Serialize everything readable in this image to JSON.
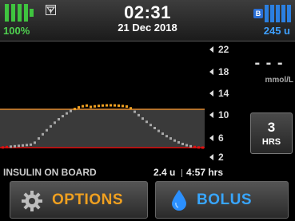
{
  "status": {
    "battery_percent": "100%",
    "battery_level": 1.0,
    "time": "02:31",
    "date": "21 Dec 2018",
    "bolus_badge": "B",
    "insulin_units": "245 u",
    "icons": [
      "battery-icon",
      "signal-icon",
      "insulin-cartridge-icon"
    ]
  },
  "graph": {
    "y_axis_ticks": [
      "22",
      "18",
      "14",
      "10",
      "6",
      "2"
    ],
    "colors": {
      "target_band": "#3a3a3a",
      "high_limit": "#e08a30",
      "low_limit": "#e01010",
      "trace_in_range": "#a8a8a8",
      "trace_high": "#f0a020",
      "trace_low": "#e01010"
    }
  },
  "glucose": {
    "value": "- - -",
    "unit": "mmol/L"
  },
  "time_range": {
    "value": "3",
    "label": "HRS"
  },
  "insulin_on_board": {
    "label": "INSULIN ON BOARD",
    "units": "2.4 u",
    "time": "4:57 hrs"
  },
  "buttons": {
    "options_label": "OPTIONS",
    "bolus_label": "BOLUS"
  }
}
